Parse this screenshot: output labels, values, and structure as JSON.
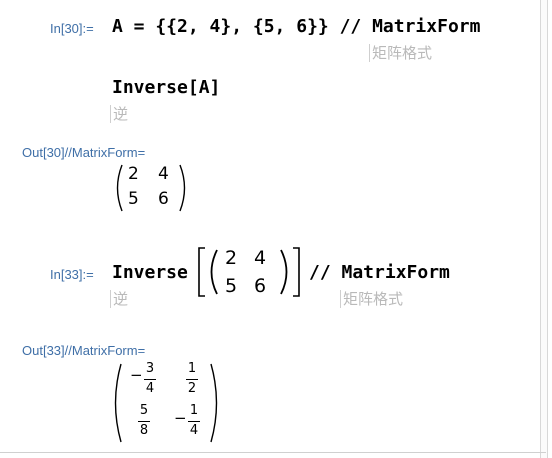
{
  "cells": {
    "in30": {
      "label": "In[30]:=",
      "line1": "A = {{2, 4}, {5, 6}} // MatrixForm",
      "hint1": "矩阵格式",
      "line2": "Inverse[A]",
      "hint2": "逆"
    },
    "out30": {
      "label": "Out[30]//MatrixForm=",
      "matrix": [
        [
          "2",
          "4"
        ],
        [
          "5",
          "6"
        ]
      ]
    },
    "in33": {
      "label": "In[33]:=",
      "func": "Inverse",
      "matrix": [
        [
          "2",
          "4"
        ],
        [
          "5",
          "6"
        ]
      ],
      "suffix": "// MatrixForm",
      "hint_inverse": "逆",
      "hint_matrixform": "矩阵格式"
    },
    "out33": {
      "label": "Out[33]//MatrixForm=",
      "matrix": [
        [
          {
            "sign": "−",
            "num": "3",
            "den": "4"
          },
          {
            "sign": "",
            "num": "1",
            "den": "2"
          }
        ],
        [
          {
            "sign": "",
            "num": "5",
            "den": "8"
          },
          {
            "sign": "−",
            "num": "1",
            "den": "4"
          }
        ]
      ]
    }
  },
  "colors": {
    "label": "#3f6fa7",
    "hint": "#b9b9b9"
  }
}
